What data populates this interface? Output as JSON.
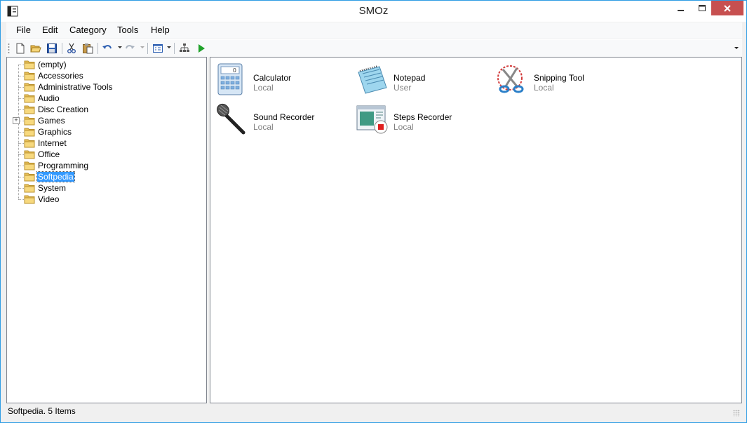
{
  "window": {
    "title": "SMOz"
  },
  "menu": [
    "File",
    "Edit",
    "Category",
    "Tools",
    "Help"
  ],
  "toolbar": {
    "new": "new-document-icon",
    "open": "open-folder-icon",
    "save": "save-icon",
    "cut": "cut-icon",
    "paste": "paste-icon",
    "undo": "undo-icon",
    "redo": "redo-icon",
    "view": "view-icon",
    "tree": "tree-icon",
    "run": "run-icon"
  },
  "tree": {
    "items": [
      {
        "label": "(empty)"
      },
      {
        "label": "Accessories"
      },
      {
        "label": "Administrative Tools"
      },
      {
        "label": "Audio"
      },
      {
        "label": "Disc Creation"
      },
      {
        "label": "Games",
        "expandable": true
      },
      {
        "label": "Graphics"
      },
      {
        "label": "Internet"
      },
      {
        "label": "Office"
      },
      {
        "label": "Programming"
      },
      {
        "label": "Softpedia",
        "selected": true
      },
      {
        "label": "System"
      },
      {
        "label": "Video"
      }
    ]
  },
  "apps": [
    {
      "name": "Calculator",
      "source": "Local"
    },
    {
      "name": "Notepad",
      "source": "User"
    },
    {
      "name": "Snipping Tool",
      "source": "Local"
    },
    {
      "name": "Sound Recorder",
      "source": "Local"
    },
    {
      "name": "Steps Recorder",
      "source": "Local"
    }
  ],
  "status": {
    "text": "Softpedia. 5 Items"
  },
  "colors": {
    "accent": "#3399ff",
    "close_button": "#c75050",
    "window_border": "#2f9de4"
  }
}
